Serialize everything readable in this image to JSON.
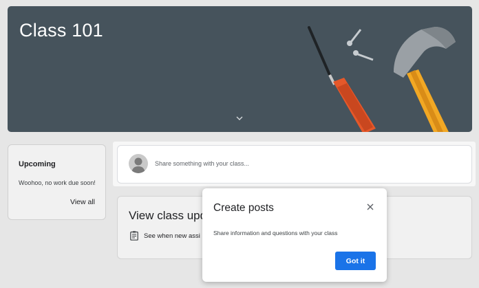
{
  "banner": {
    "title": "Class 101",
    "background_color": "#46535c",
    "expand_icon": "chevron-down-icon"
  },
  "upcoming": {
    "title": "Upcoming",
    "message": "Woohoo, no work due soon!",
    "view_all_label": "View all"
  },
  "stream": {
    "share_placeholder": "Share something with your class...",
    "avatar_icon": "person-icon"
  },
  "updates": {
    "title": "View class upda",
    "icon": "assignment-icon",
    "description": "See when new assi"
  },
  "dialog": {
    "title": "Create posts",
    "body": "Share information and questions with your class",
    "button_label": "Got it",
    "close_icon": "close-icon",
    "accent_color": "#1a73e8"
  }
}
